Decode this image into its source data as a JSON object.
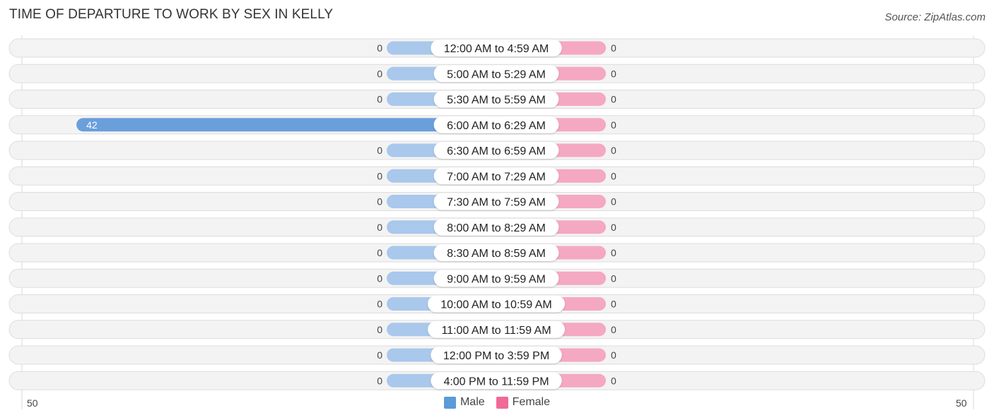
{
  "title": "TIME OF DEPARTURE TO WORK BY SEX IN KELLY",
  "source": "Source: ZipAtlas.com",
  "colors": {
    "male": "#6a9fdc",
    "male_light": "#a9c8ec",
    "female": "#f06a96",
    "female_light": "#f5a8c2",
    "row_bg": "#f3f3f3",
    "row_border": "#dddddd"
  },
  "legend": [
    {
      "label": "Male",
      "color": "#5b9bd8"
    },
    {
      "label": "Female",
      "color": "#f06a96"
    }
  ],
  "axis": {
    "left_label": "50",
    "right_label": "50"
  },
  "chart_data": {
    "type": "bar",
    "orientation": "horizontal-diverging",
    "title": "TIME OF DEPARTURE TO WORK BY SEX IN KELLY",
    "categories": [
      "12:00 AM to 4:59 AM",
      "5:00 AM to 5:29 AM",
      "5:30 AM to 5:59 AM",
      "6:00 AM to 6:29 AM",
      "6:30 AM to 6:59 AM",
      "7:00 AM to 7:29 AM",
      "7:30 AM to 7:59 AM",
      "8:00 AM to 8:29 AM",
      "8:30 AM to 8:59 AM",
      "9:00 AM to 9:59 AM",
      "10:00 AM to 10:59 AM",
      "11:00 AM to 11:59 AM",
      "12:00 PM to 3:59 PM",
      "4:00 PM to 11:59 PM"
    ],
    "series": [
      {
        "name": "Male",
        "values": [
          0,
          0,
          0,
          42,
          0,
          0,
          0,
          0,
          0,
          0,
          0,
          0,
          0,
          0
        ]
      },
      {
        "name": "Female",
        "values": [
          0,
          0,
          0,
          0,
          0,
          0,
          0,
          0,
          0,
          0,
          0,
          0,
          0,
          0
        ]
      }
    ],
    "xlim": [
      -50,
      50
    ],
    "xtick_labels": [
      "50",
      "50"
    ],
    "legend_position": "bottom-center",
    "grid": false
  }
}
